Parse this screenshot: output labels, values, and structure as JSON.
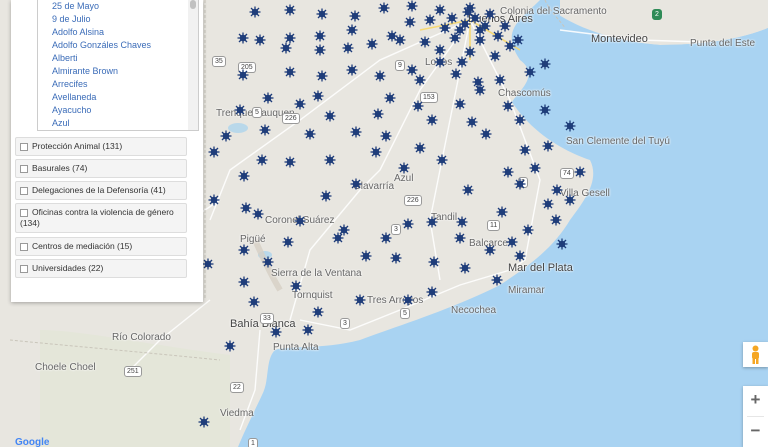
{
  "panel": {
    "departments": [
      "25 de Mayo",
      "9 de Julio",
      "Adolfo Alsina",
      "Adolfo Gonzáles Chaves",
      "Alberti",
      "Almirante Brown",
      "Arrecifes",
      "Avellaneda",
      "Ayacucho",
      "Azul"
    ],
    "layers": [
      "Protección Animal (131)",
      "Basurales (74)",
      "Delegaciones de la Defensoría (41)",
      "Oficinas contra la violencia de género (134)",
      "Centros de mediación (15)",
      "Universidades (22)"
    ]
  },
  "map": {
    "cities": {
      "buenos_aires": "Buenos Aires",
      "montevideo": "Montevideo",
      "mar_del_plata": "Mar del Plata",
      "bahia_blanca": "Bahía Blanca",
      "olavarria": "Olavarría",
      "tandil": "Tandil",
      "necochea": "Necochea",
      "tres_arroyos": "Tres Arroyos",
      "pigue": "Pigüé",
      "coronel_suarez": "Coronel Suárez",
      "sierra_de_la_ventana": "Sierra de la Ventana",
      "trenque_lauquen": "Trenque Lauquen",
      "san_clemente": "San Clemente del Tuyú",
      "villa_gesell": "Villa Gesell",
      "lobos": "Lobos",
      "miramar": "Miramar",
      "balcarce": "Balcarce",
      "azul": "Azul",
      "punta_alta": "Punta Alta",
      "choele_choel": "Choele Choel",
      "carmen_de_patagones": "Viedma",
      "rio_colorado": "Río Colorado",
      "tornquist": "Tornquist",
      "chascomus": "Chascomús",
      "colonia": "Colonia del Sacramento",
      "punta_del_este": "Punta del Este"
    },
    "shields": [
      "5",
      "205",
      "226",
      "3",
      "33",
      "35",
      "2",
      "11",
      "74",
      "1",
      "251",
      "22",
      "153",
      "9",
      "3",
      "2",
      "226",
      "5"
    ],
    "markers_count": 140,
    "marker_color": "#1f3d7a",
    "land_color": "#e8e6e0",
    "water_color": "#a9d3f2"
  },
  "controls": {
    "zoom_in": "+",
    "zoom_out": "−",
    "google": "Google"
  }
}
